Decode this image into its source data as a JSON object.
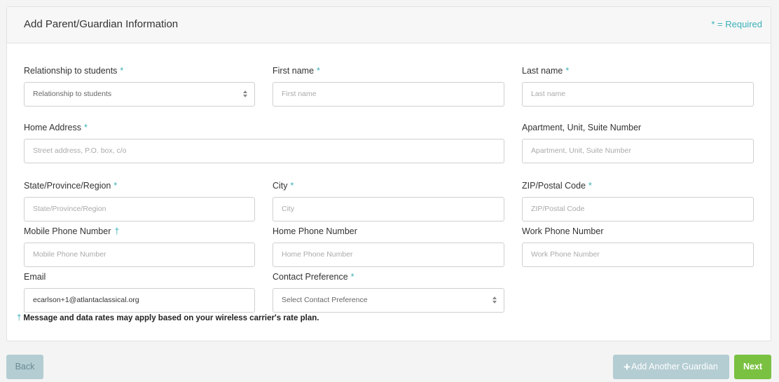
{
  "header": {
    "title": "Add Parent/Guardian Information",
    "required_note": "* = Required"
  },
  "fields": {
    "relationship": {
      "label": "Relationship to students",
      "star": "*",
      "value": "Relationship to students"
    },
    "first_name": {
      "label": "First name",
      "star": "*",
      "placeholder": "First name"
    },
    "last_name": {
      "label": "Last name",
      "star": "*",
      "placeholder": "Last name"
    },
    "home_address": {
      "label": "Home Address",
      "star": "*",
      "placeholder": "Street address, P.O. box, c/o"
    },
    "apartment": {
      "label": "Apartment, Unit, Suite Number",
      "placeholder": "Apartment, Unit, Suite Number"
    },
    "state": {
      "label": "State/Province/Region",
      "star": "*",
      "placeholder": "State/Province/Region"
    },
    "city": {
      "label": "City",
      "star": "*",
      "placeholder": "City"
    },
    "zip": {
      "label": "ZIP/Postal Code",
      "star": "*",
      "placeholder": "ZIP/Postal Code"
    },
    "mobile_phone": {
      "label": "Mobile Phone Number",
      "dagger": "†",
      "placeholder": "Mobile Phone Number"
    },
    "home_phone": {
      "label": "Home Phone Number",
      "placeholder": "Home Phone Number"
    },
    "work_phone": {
      "label": "Work Phone Number",
      "placeholder": "Work Phone Number"
    },
    "email": {
      "label": "Email",
      "value": "ecarlson+1@atlantaclassical.org"
    },
    "contact_preference": {
      "label": "Contact Preference",
      "star": "*",
      "value": "Select Contact Preference"
    }
  },
  "footnote": {
    "dagger": "†",
    "text": "Message and data rates may apply based on your wireless carrier's rate plan."
  },
  "buttons": {
    "back": "Back",
    "add_guardian": "Add Another Guardian",
    "add_icon": "plus-icon",
    "next": "Next"
  },
  "colors": {
    "accent": "#3bb0b8",
    "next": "#7ac142",
    "disabled": "#b4cdd3"
  }
}
